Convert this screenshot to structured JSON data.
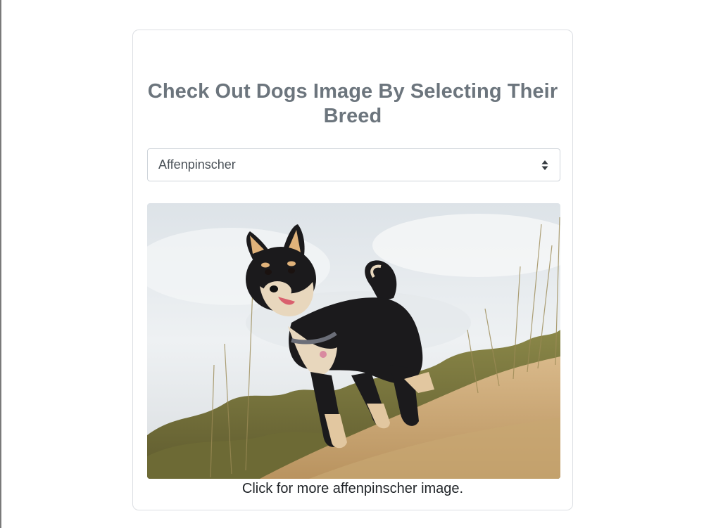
{
  "header": {
    "title": "Check Out Dogs Image By Selecting Their Breed"
  },
  "breed_select": {
    "selected": "Affenpinscher",
    "icon": "sort-arrows-icon"
  },
  "image": {
    "alt": "dog photo",
    "icon": "dog-photo"
  },
  "caption": {
    "text": "Click for more affenpinscher image."
  },
  "colors": {
    "title": "#6c757d",
    "border": "#dcdfe3",
    "text": "#212529"
  }
}
